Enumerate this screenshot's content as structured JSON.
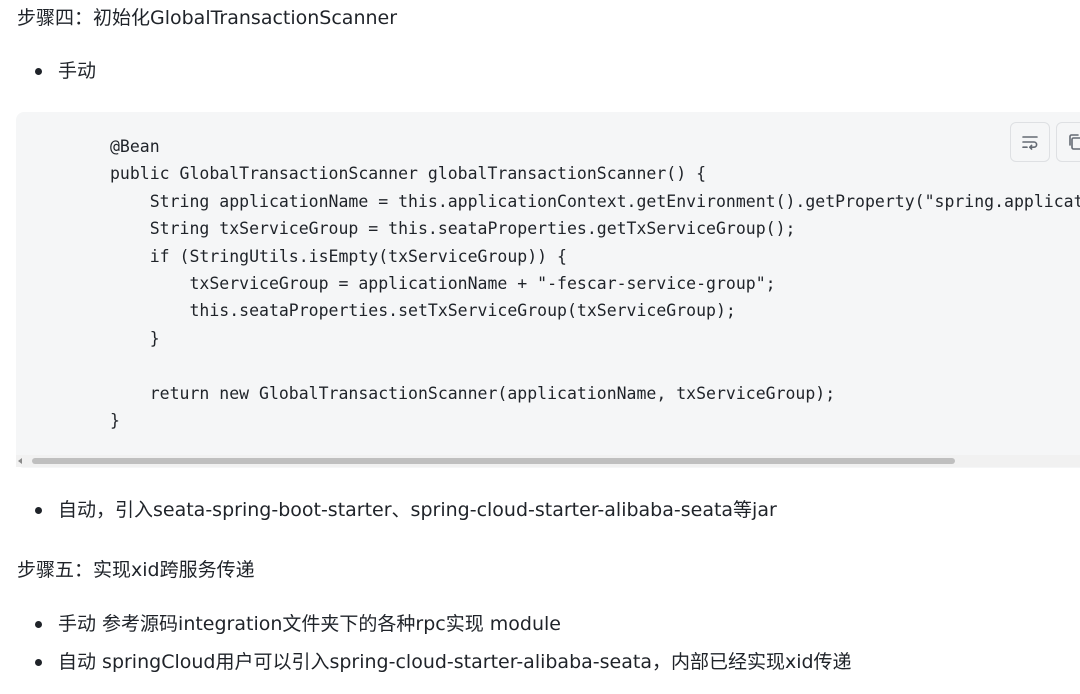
{
  "step4": {
    "heading": "步骤四：初始化GlobalTransactionScanner",
    "bullets": [
      "手动",
      "自动，引入seata-spring-boot-starter、spring-cloud-starter-alibaba-seata等jar"
    ],
    "code": {
      "lines": [
        "@Bean",
        "public GlobalTransactionScanner globalTransactionScanner() {",
        "    String applicationName = this.applicationContext.getEnvironment().getProperty(\"spring.application.name\");",
        "    String txServiceGroup = this.seataProperties.getTxServiceGroup();",
        "    if (StringUtils.isEmpty(txServiceGroup)) {",
        "        txServiceGroup = applicationName + \"-fescar-service-group\";",
        "        this.seataProperties.setTxServiceGroup(txServiceGroup);",
        "    }",
        "",
        "    return new GlobalTransactionScanner(applicationName, txServiceGroup);",
        "}"
      ],
      "toolbar_icons": [
        "wrap-lines-icon",
        "copy-icon"
      ]
    }
  },
  "step5": {
    "heading": "步骤五：实现xid跨服务传递",
    "bullets": [
      "手动 参考源码integration文件夹下的各种rpc实现 module",
      "自动 springCloud用户可以引入spring-cloud-starter-alibaba-seata，内部已经实现xid传递"
    ]
  },
  "colors": {
    "text": "#1f2329",
    "code_background": "#f5f6f7",
    "scrollbar_thumb": "#bfbfbf"
  }
}
